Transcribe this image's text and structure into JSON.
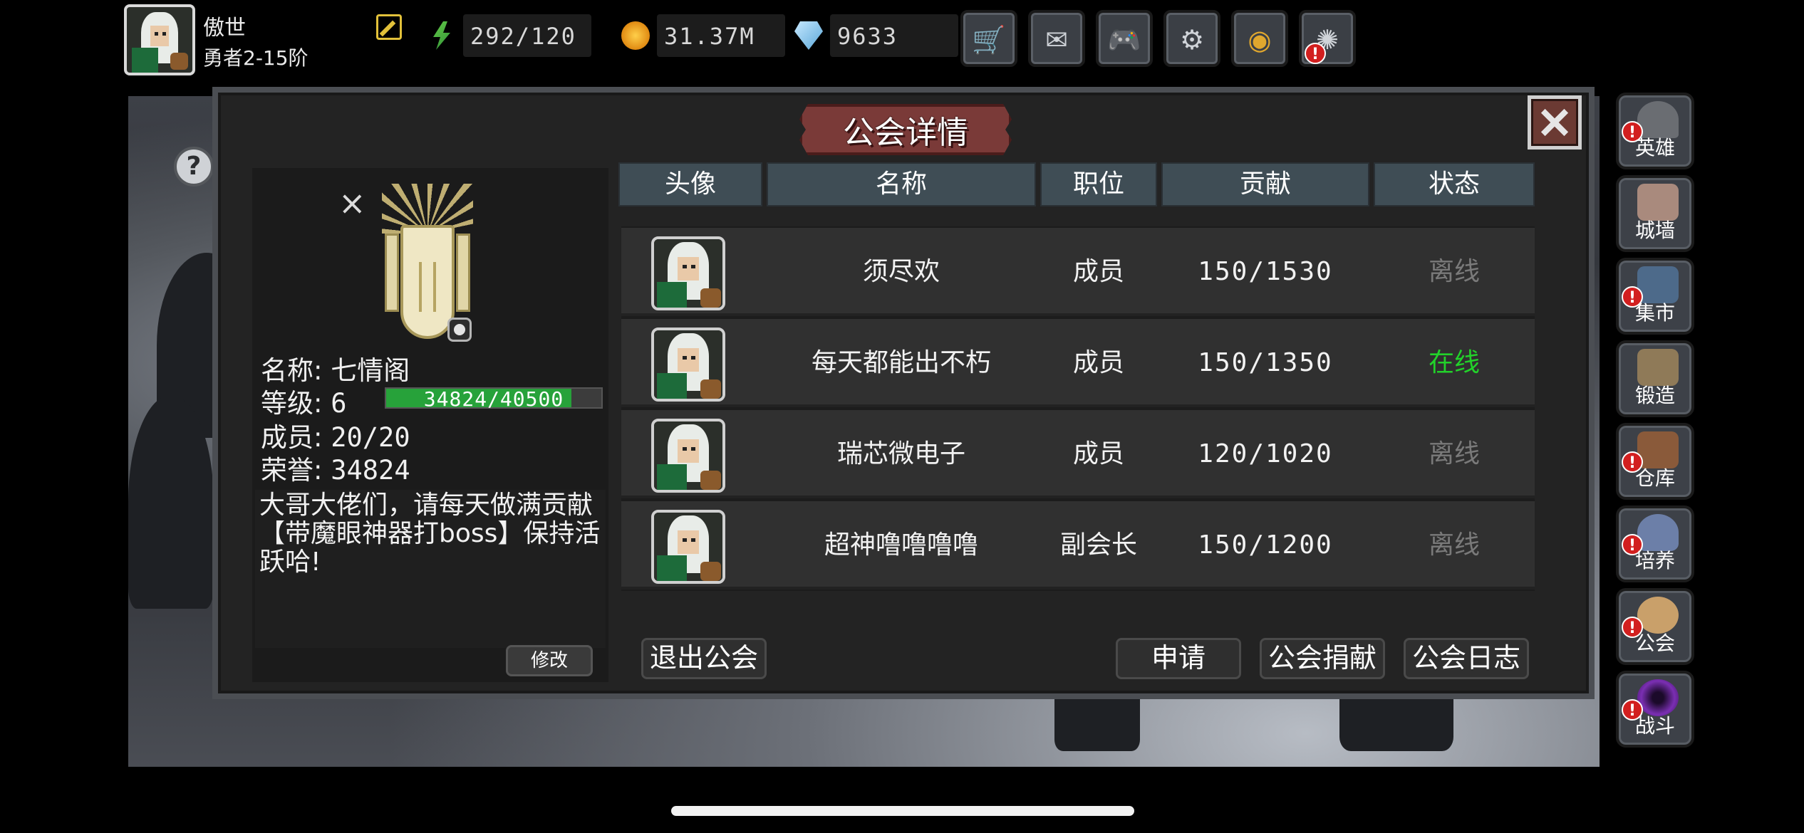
{
  "player": {
    "name": "傲世",
    "rank": "勇者2-15阶"
  },
  "resources": {
    "energy": "292/120",
    "gold": "31.37M",
    "gems": "9633"
  },
  "top_buttons": [
    {
      "name": "shop",
      "icon": "cart-icon",
      "glyph": "🛒"
    },
    {
      "name": "mail",
      "icon": "mail-icon",
      "glyph": "✉"
    },
    {
      "name": "gamepad",
      "icon": "gamepad-icon",
      "glyph": "🎮"
    },
    {
      "name": "settings",
      "icon": "gear-icon",
      "glyph": "⚙"
    },
    {
      "name": "aperture",
      "icon": "aperture-icon",
      "glyph": "◉"
    },
    {
      "name": "fireworks",
      "icon": "fireworks-icon",
      "glyph": "✺",
      "alert": "!"
    }
  ],
  "side_menu": [
    {
      "label": "英雄",
      "alert": "!",
      "color": "#6a6d72"
    },
    {
      "label": "城墙",
      "color": "#a98a7d"
    },
    {
      "label": "集市",
      "alert": "!",
      "color": "#4d6a8a"
    },
    {
      "label": "锻造",
      "color": "#8f7a58"
    },
    {
      "label": "仓库",
      "alert": "!",
      "color": "#8a5a3a"
    },
    {
      "label": "培养",
      "alert": "!",
      "color": "#6c7fa8"
    },
    {
      "label": "公会",
      "alert": "!",
      "color": "#c9a06a"
    },
    {
      "label": "战斗",
      "alert": "!",
      "color": "#7a2fb2"
    }
  ],
  "dialog": {
    "title": "公会详情",
    "help_glyph": "?",
    "close_glyph": "×"
  },
  "guild": {
    "name_label": "名称:",
    "name": "七情阁",
    "level_label": "等级:",
    "level": "6",
    "xp_text": "34824/40500",
    "xp_fraction": 0.86,
    "members_label": "成员:",
    "members": "20/20",
    "honor_label": "荣誉:",
    "honor": "34824",
    "notice": "大哥大佬们，请每天做满贡献【带魔眼神器打boss】保持活跃哈!",
    "modify_label": "修改"
  },
  "table": {
    "headers": [
      "头像",
      "名称",
      "职位",
      "贡献",
      "状态"
    ],
    "rows": [
      {
        "name": "须尽欢",
        "position": "成员",
        "contribution": "150/1530",
        "status": "离线",
        "status_color": "#7a7a7a"
      },
      {
        "name": "每天都能出不朽",
        "position": "成员",
        "contribution": "150/1350",
        "status": "在线",
        "status_color": "#22d22a"
      },
      {
        "name": "瑞芯微电子",
        "position": "成员",
        "contribution": "120/1020",
        "status": "离线",
        "status_color": "#7a7a7a"
      },
      {
        "name": "超神噜噜噜噜",
        "position": "副会长",
        "contribution": "150/1200",
        "status": "离线",
        "status_color": "#7a7a7a"
      }
    ]
  },
  "buttons": {
    "leave": "退出公会",
    "apply": "申请",
    "donate": "公会捐献",
    "log": "公会日志"
  }
}
